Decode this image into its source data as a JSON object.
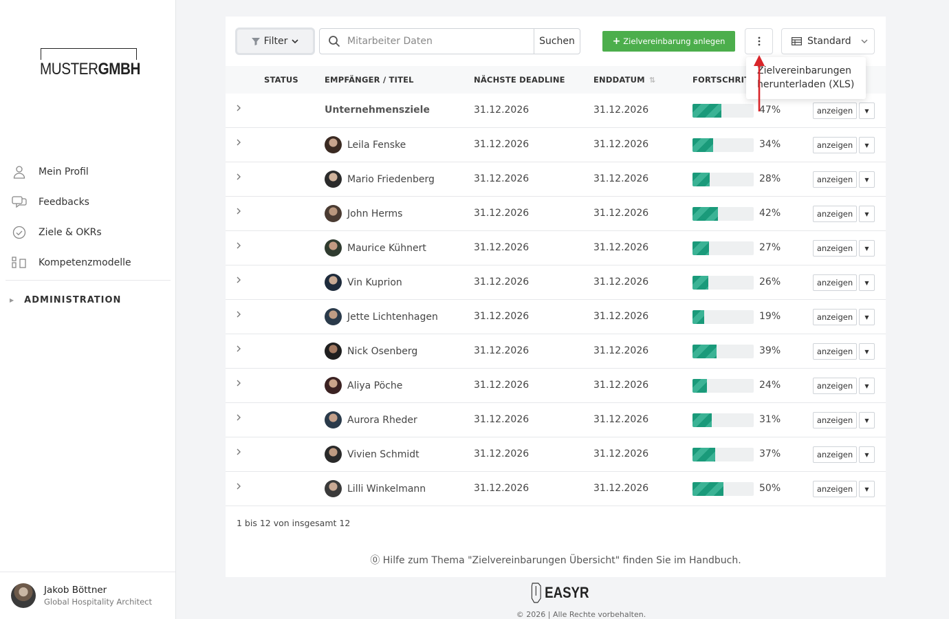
{
  "brand": {
    "logo_light": "MUSTER",
    "logo_bold": "GMBH"
  },
  "sidebar": {
    "items": [
      {
        "label": "Mein Profil",
        "icon": "user-icon"
      },
      {
        "label": "Feedbacks",
        "icon": "chat-icon"
      },
      {
        "label": "Ziele & OKRs",
        "icon": "check-circle-icon"
      },
      {
        "label": "Kompetenzmodelle",
        "icon": "grid-icon"
      }
    ],
    "admin_label": "ADMINISTRATION"
  },
  "user": {
    "name": "Jakob Böttner",
    "role": "Global Hospitality Architect"
  },
  "toolbar": {
    "filter_label": "Filter",
    "search_placeholder": "Mitarbeiter Daten",
    "search_button": "Suchen",
    "add_button": "Zielvereinbarung anlegen",
    "view_label": "Standard"
  },
  "dropdown": {
    "line1": "Zielvereinbarungen",
    "line2": "herunterladen (XLS)"
  },
  "table": {
    "headers": {
      "status": "STATUS",
      "recipient": "EMPFÄNGER / TITEL",
      "deadline": "NÄCHSTE DEADLINE",
      "enddate": "ENDDATUM",
      "progress": "FORTSCHRITT"
    },
    "show_label": "anzeigen",
    "rows": [
      {
        "name": "Unternehmensziele",
        "deadline": "31.12.2026",
        "enddate": "31.12.2026",
        "progress": 47,
        "pct": "47%",
        "bold": true
      },
      {
        "name": "Leila Fenske",
        "deadline": "31.12.2026",
        "enddate": "31.12.2026",
        "progress": 34,
        "pct": "34%"
      },
      {
        "name": "Mario Friedenberg",
        "deadline": "31.12.2026",
        "enddate": "31.12.2026",
        "progress": 28,
        "pct": "28%"
      },
      {
        "name": "John Herms",
        "deadline": "31.12.2026",
        "enddate": "31.12.2026",
        "progress": 42,
        "pct": "42%"
      },
      {
        "name": "Maurice Kühnert",
        "deadline": "31.12.2026",
        "enddate": "31.12.2026",
        "progress": 27,
        "pct": "27%"
      },
      {
        "name": "Vin Kuprion",
        "deadline": "31.12.2026",
        "enddate": "31.12.2026",
        "progress": 26,
        "pct": "26%"
      },
      {
        "name": "Jette Lichtenhagen",
        "deadline": "31.12.2026",
        "enddate": "31.12.2026",
        "progress": 19,
        "pct": "19%"
      },
      {
        "name": "Nick Osenberg",
        "deadline": "31.12.2026",
        "enddate": "31.12.2026",
        "progress": 39,
        "pct": "39%"
      },
      {
        "name": "Aliya Pöche",
        "deadline": "31.12.2026",
        "enddate": "31.12.2026",
        "progress": 24,
        "pct": "24%"
      },
      {
        "name": "Aurora Rheder",
        "deadline": "31.12.2026",
        "enddate": "31.12.2026",
        "progress": 31,
        "pct": "31%"
      },
      {
        "name": "Vivien Schmidt",
        "deadline": "31.12.2026",
        "enddate": "31.12.2026",
        "progress": 37,
        "pct": "37%"
      },
      {
        "name": "Lilli Winkelmann",
        "deadline": "31.12.2026",
        "enddate": "31.12.2026",
        "progress": 50,
        "pct": "50%"
      }
    ]
  },
  "pager_info": "1 bis 12 von insgesamt 12",
  "help_text": "Hilfe zum Thema \"Zielvereinbarungen Übersicht\" finden Sie im Handbuch.",
  "footer": {
    "logo": "EASYR",
    "copyright": "© 2026 | Alle Rechte vorbehalten."
  },
  "colors": {
    "accent_green": "#4cae4c",
    "progress_teal": "#1a9a7a",
    "arrow_red": "#d9252a"
  }
}
